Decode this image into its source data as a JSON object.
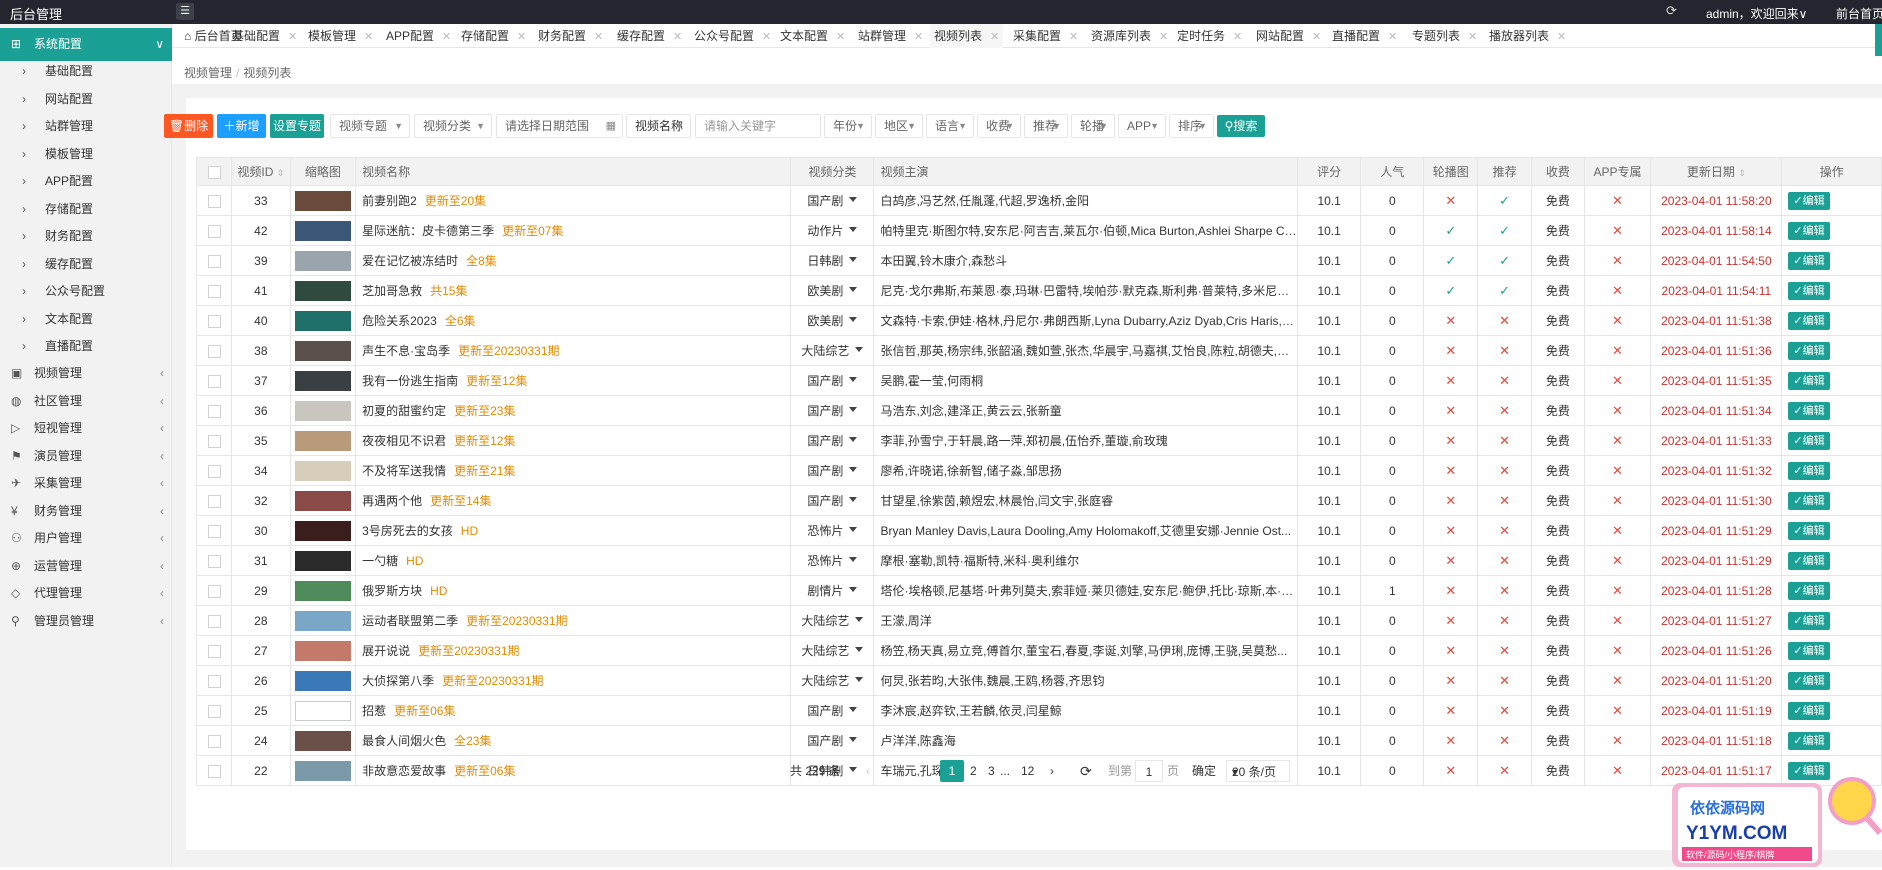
{
  "header": {
    "logo": "后台管理",
    "toggle": "☰",
    "user": "admin，欢迎回来∨",
    "front": "前台首页"
  },
  "sidebar": {
    "system": "系统配置",
    "sub": [
      "基础配置",
      "网站配置",
      "站群管理",
      "模板管理",
      "APP配置",
      "存储配置",
      "财务配置",
      "缓存配置",
      "公众号配置",
      "文本配置",
      "直播配置"
    ],
    "groups": [
      {
        "label": "视频管理",
        "icon": "▣"
      },
      {
        "label": "社区管理",
        "icon": "◍"
      },
      {
        "label": "短视管理",
        "icon": "▷"
      },
      {
        "label": "演员管理",
        "icon": "⚑"
      },
      {
        "label": "采集管理",
        "icon": "✈"
      },
      {
        "label": "财务管理",
        "icon": "¥"
      },
      {
        "label": "用户管理",
        "icon": "⚇"
      },
      {
        "label": "运营管理",
        "icon": "⊕"
      },
      {
        "label": "代理管理",
        "icon": "◇"
      },
      {
        "label": "管理员管理",
        "icon": "⚲"
      }
    ]
  },
  "tabs": [
    "后台首页",
    "基础配置",
    "模板管理",
    "APP配置",
    "存储配置",
    "财务配置",
    "缓存配置",
    "公众号配置",
    "文本配置",
    "站群管理",
    "视频列表",
    "采集配置",
    "资源库列表",
    "定时任务",
    "网站配置",
    "直播配置",
    "专题列表",
    "播放器列表"
  ],
  "breadcrumb": [
    "视频管理",
    "视频列表"
  ],
  "toolbar": {
    "delete": "删除",
    "add": "新增",
    "topic": "设置专题",
    "search": "搜索"
  },
  "filters": {
    "topic": "视频专题",
    "category": "视频分类",
    "date": "请选择日期范围",
    "field": "视频名称",
    "keyword": "请输入关键字",
    "year": "年份",
    "region": "地区",
    "language": "语言",
    "charge": "收费",
    "recommend": "推荐",
    "carousel": "轮播",
    "app": "APP",
    "sort": "排序"
  },
  "columns": [
    "视频ID",
    "缩略图",
    "视频名称",
    "视频分类",
    "视频主演",
    "评分",
    "人气",
    "轮播图",
    "推荐",
    "收费",
    "APP专属",
    "更新日期",
    "操作"
  ],
  "actions": {
    "edit": "编辑",
    "del": "删除"
  },
  "rows": [
    {
      "id": "33",
      "name": "前妻别跑2",
      "ep": "更新至20集",
      "cat": "国产剧",
      "actors": "白鸪彦,冯艺然,任胤蓬,代超,罗逸桥,金阳",
      "score": "10.1",
      "hot": "0",
      "car": false,
      "rec": true,
      "fee": "免费",
      "app": false,
      "date": "2023-04-01 11:58:20",
      "c": "#6a4a3a"
    },
    {
      "id": "42",
      "name": "星际迷航：皮卡德第三季",
      "ep": "更新至07集",
      "cat": "动作片",
      "actors": "帕特里克·斯图尔特,安东尼·阿吉吉,莱瓦尔·伯顿,Mica Burton,Ashlei Sharpe Ch...",
      "score": "10.1",
      "hot": "0",
      "car": true,
      "rec": true,
      "fee": "免费",
      "app": false,
      "date": "2023-04-01 11:58:14",
      "c": "#3b5878"
    },
    {
      "id": "39",
      "name": "爱在记忆被冻结时",
      "ep": "全8集",
      "cat": "日韩剧",
      "actors": "本田翼,铃木康介,森愁斗",
      "score": "10.1",
      "hot": "0",
      "car": true,
      "rec": true,
      "fee": "免费",
      "app": false,
      "date": "2023-04-01 11:54:50",
      "c": "#9aa4ac"
    },
    {
      "id": "41",
      "name": "芝加哥急救",
      "ep": "共15集",
      "cat": "欧美剧",
      "actors": "尼克·戈尔弗斯,布莱恩·泰,玛琳·巴雷特,埃帕莎·默克森,斯利弗·普莱特,多米尼克...",
      "score": "10.1",
      "hot": "0",
      "car": true,
      "rec": true,
      "fee": "免费",
      "app": false,
      "date": "2023-04-01 11:54:11",
      "c": "#2f4a3f"
    },
    {
      "id": "40",
      "name": "危险关系2023",
      "ep": "全6集",
      "cat": "欧美剧",
      "actors": "文森特·卡索,伊娃·格林,丹尼尔·弗朗西斯,Lyna Dubarry,Aziz Dyab,Cris Haris,奥...",
      "score": "10.1",
      "hot": "0",
      "car": false,
      "rec": false,
      "fee": "免费",
      "app": false,
      "date": "2023-04-01 11:51:38",
      "c": "#1f6f6a"
    },
    {
      "id": "38",
      "name": "声生不息·宝岛季",
      "ep": "更新至20230331期",
      "cat": "大陆综艺",
      "actors": "张信哲,那英,杨宗纬,张韶涵,魏如萱,张杰,华晨宇,马嘉祺,艾怡良,陈粒,胡德夫,坏特...",
      "score": "10.1",
      "hot": "0",
      "car": false,
      "rec": false,
      "fee": "免费",
      "app": false,
      "date": "2023-04-01 11:51:36",
      "c": "#5a4f4a"
    },
    {
      "id": "37",
      "name": "我有一份逃生指南",
      "ep": "更新至12集",
      "cat": "国产剧",
      "actors": "吴鹏,霍一莹,何雨桐",
      "score": "10.1",
      "hot": "0",
      "car": false,
      "rec": false,
      "fee": "免费",
      "app": false,
      "date": "2023-04-01 11:51:35",
      "c": "#3a3f44"
    },
    {
      "id": "36",
      "name": "初夏的甜蜜约定",
      "ep": "更新至23集",
      "cat": "国产剧",
      "actors": "马浩东,刘念,建泽正,黄云云,张新童",
      "score": "10.1",
      "hot": "0",
      "car": false,
      "rec": false,
      "fee": "免费",
      "app": false,
      "date": "2023-04-01 11:51:34",
      "c": "#c9c6c0"
    },
    {
      "id": "35",
      "name": "夜夜相见不识君",
      "ep": "更新至12集",
      "cat": "国产剧",
      "actors": "李菲,孙雪宁,于轩晨,路一萍,郑初晨,伍怡乔,董璇,俞玫瑰",
      "score": "10.1",
      "hot": "0",
      "car": false,
      "rec": false,
      "fee": "免费",
      "app": false,
      "date": "2023-04-01 11:51:33",
      "c": "#b99a7a"
    },
    {
      "id": "34",
      "name": "不及将军送我情",
      "ep": "更新至21集",
      "cat": "国产剧",
      "actors": "廖希,许晓诺,徐新智,储子淼,邹思扬",
      "score": "10.1",
      "hot": "0",
      "car": false,
      "rec": false,
      "fee": "免费",
      "app": false,
      "date": "2023-04-01 11:51:32",
      "c": "#d8cdbb"
    },
    {
      "id": "32",
      "name": "再遇两个他",
      "ep": "更新至14集",
      "cat": "国产剧",
      "actors": "甘望星,徐紫茵,赖煜宏,林晨怡,闫文宇,张庭睿",
      "score": "10.1",
      "hot": "0",
      "car": false,
      "rec": false,
      "fee": "免费",
      "app": false,
      "date": "2023-04-01 11:51:30",
      "c": "#8a4a48"
    },
    {
      "id": "30",
      "name": "3号房死去的女孩",
      "ep": "HD",
      "cat": "恐怖片",
      "actors": "Bryan Manley Davis,Laura Dooling,Amy Holomakoff,艾德里安娜·Jennie Ost...",
      "score": "10.1",
      "hot": "0",
      "car": false,
      "rec": false,
      "fee": "免费",
      "app": false,
      "date": "2023-04-01 11:51:29",
      "c": "#3a1e1e"
    },
    {
      "id": "31",
      "name": "一勺糖",
      "ep": "HD",
      "cat": "恐怖片",
      "actors": "摩根·塞勒,凯特·福斯特,米科·奥利维尔",
      "score": "10.1",
      "hot": "0",
      "car": false,
      "rec": false,
      "fee": "免费",
      "app": false,
      "date": "2023-04-01 11:51:29",
      "c": "#2a2a2a"
    },
    {
      "id": "29",
      "name": "俄罗斯方块",
      "ep": "HD",
      "cat": "剧情片",
      "actors": "塔伦·埃格顿,尼基塔·叶弗列莫夫,索菲娅·莱贝德娃,安东尼·鲍伊,托比·琼斯,本·迈...",
      "score": "10.1",
      "hot": "1",
      "car": false,
      "rec": false,
      "fee": "免费",
      "app": false,
      "date": "2023-04-01 11:51:28",
      "c": "#4f8a5a"
    },
    {
      "id": "28",
      "name": "运动者联盟第二季",
      "ep": "更新至20230331期",
      "cat": "大陆综艺",
      "actors": "王濛,周洋",
      "score": "10.1",
      "hot": "0",
      "car": false,
      "rec": false,
      "fee": "免费",
      "app": false,
      "date": "2023-04-01 11:51:27",
      "c": "#7aa6c8"
    },
    {
      "id": "27",
      "name": "展开说说",
      "ep": "更新至20230331期",
      "cat": "大陆综艺",
      "actors": "杨笠,杨天真,易立竞,傅首尔,董宝石,春夏,李诞,刘擎,马伊琍,庞博,王骁,吴莫愁...",
      "score": "10.1",
      "hot": "0",
      "car": false,
      "rec": false,
      "fee": "免费",
      "app": false,
      "date": "2023-04-01 11:51:26",
      "c": "#c47a6a"
    },
    {
      "id": "26",
      "name": "大侦探第八季",
      "ep": "更新至20230331期",
      "cat": "大陆综艺",
      "actors": "何炅,张若昀,大张伟,魏晨,王鸥,杨蓉,齐思钧",
      "score": "10.1",
      "hot": "0",
      "car": false,
      "rec": false,
      "fee": "免费",
      "app": false,
      "date": "2023-04-01 11:51:20",
      "c": "#3b78b8"
    },
    {
      "id": "25",
      "name": "招惹",
      "ep": "更新至06集",
      "cat": "国产剧",
      "actors": "李沐宸,赵弈钦,王若麟,依灵,闫星鲸",
      "score": "10.1",
      "hot": "0",
      "car": false,
      "rec": false,
      "fee": "免费",
      "app": false,
      "date": "2023-04-01 11:51:19",
      "c": "#ffffff"
    },
    {
      "id": "24",
      "name": "最食人间烟火色",
      "ep": "全23集",
      "cat": "国产剧",
      "actors": "卢洋洋,陈鑫海",
      "score": "10.1",
      "hot": "0",
      "car": false,
      "rec": false,
      "fee": "免费",
      "app": false,
      "date": "2023-04-01 11:51:18",
      "c": "#6a5048"
    },
    {
      "id": "22",
      "name": "非故意恋爱故事",
      "ep": "更新至06集",
      "cat": "日韩剧",
      "actors": "车瑞元,孔琛",
      "score": "10.1",
      "hot": "0",
      "car": false,
      "rec": false,
      "fee": "免费",
      "app": false,
      "date": "2023-04-01 11:51:17",
      "c": "#7a9aaa"
    }
  ],
  "pager": {
    "total": "共 229 条",
    "p1": "1",
    "p2": "2",
    "p3": "3",
    "dots": "...",
    "last": "12",
    "goto": "到第",
    "page": "1",
    "unit": "页",
    "ok": "确定",
    "size": "20 条/页"
  },
  "watermark": {
    "line1": "依依源码网",
    "line2": "Y1YM.COM",
    "line3": "软件/源码/小程序/棋牌"
  },
  "colors": {
    "accent": "#1aa094",
    "danger": "#ff5722",
    "header": "#23262e",
    "warn": "#e28b00"
  }
}
